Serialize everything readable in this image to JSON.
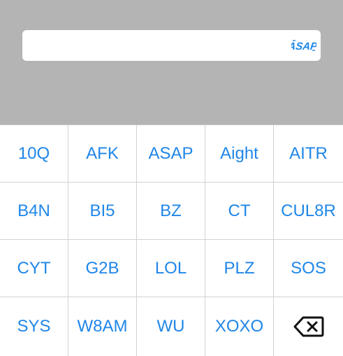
{
  "search": {
    "value": "",
    "logo_text": "ASAP",
    "logo_icon": "asap-logo-icon"
  },
  "keyboard": {
    "keys": [
      "10Q",
      "AFK",
      "ASAP",
      "Aight",
      "AITR",
      "B4N",
      "BI5",
      "BZ",
      "CT",
      "CUL8R",
      "CYT",
      "G2B",
      "LOL",
      "PLZ",
      "SOS",
      "SYS",
      "W8AM",
      "WU",
      "XOXO"
    ],
    "delete_icon": "backspace-icon"
  },
  "colors": {
    "background": "#b4b4b4",
    "key_text": "#1f86e8",
    "key_background": "#ffffff",
    "divider": "#d2d2d2"
  }
}
